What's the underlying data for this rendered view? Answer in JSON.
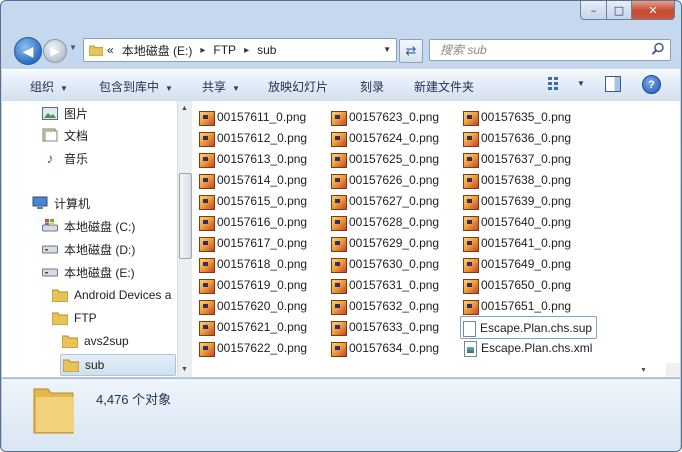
{
  "window": {
    "caption_buttons": {
      "minimize": "–",
      "maximize": "□",
      "close": "✕"
    }
  },
  "address": {
    "prefix": "«",
    "crumbs": [
      "本地磁盘 (E:)",
      "FTP",
      "sub"
    ],
    "separator": "▸"
  },
  "search": {
    "placeholder": "搜索 sub"
  },
  "toolbar": {
    "items": [
      "组织",
      "包含到库中",
      "共享",
      "放映幻灯片",
      "刻录",
      "新建文件夹"
    ],
    "help": "?"
  },
  "nav": {
    "items": [
      {
        "label": "图片",
        "icon": "pictures-icon"
      },
      {
        "label": "文档",
        "icon": "documents-icon"
      },
      {
        "label": "音乐",
        "icon": "music-icon"
      },
      {
        "label": "计算机",
        "icon": "computer-icon"
      },
      {
        "label": "本地磁盘 (C:)",
        "icon": "windows-drive-icon"
      },
      {
        "label": "本地磁盘 (D:)",
        "icon": "drive-icon"
      },
      {
        "label": "本地磁盘 (E:)",
        "icon": "drive-icon"
      },
      {
        "label": "Android Devices a",
        "icon": "folder-icon"
      },
      {
        "label": "FTP",
        "icon": "folder-icon"
      },
      {
        "label": "avs2sup",
        "icon": "folder-icon"
      },
      {
        "label": "sub",
        "icon": "folder-icon"
      }
    ]
  },
  "files": {
    "col1": [
      "00157611_0.png",
      "00157612_0.png",
      "00157613_0.png",
      "00157614_0.png",
      "00157615_0.png",
      "00157616_0.png",
      "00157617_0.png",
      "00157618_0.png",
      "00157619_0.png",
      "00157620_0.png",
      "00157621_0.png",
      "00157622_0.png"
    ],
    "col2": [
      "00157623_0.png",
      "00157624_0.png",
      "00157625_0.png",
      "00157626_0.png",
      "00157627_0.png",
      "00157628_0.png",
      "00157629_0.png",
      "00157630_0.png",
      "00157631_0.png",
      "00157632_0.png",
      "00157633_0.png",
      "00157634_0.png"
    ],
    "col3": [
      "00157635_0.png",
      "00157636_0.png",
      "00157637_0.png",
      "00157638_0.png",
      "00157639_0.png",
      "00157640_0.png",
      "00157641_0.png",
      "00157649_0.png",
      "00157650_0.png",
      "00157651_0.png",
      "Escape.Plan.chs.sup",
      "Escape.Plan.chs.xml"
    ]
  },
  "status": {
    "count_text": "4,476 个对象"
  },
  "colors": {
    "accent": "#2c6fc2",
    "selection": "#cfdfef"
  }
}
